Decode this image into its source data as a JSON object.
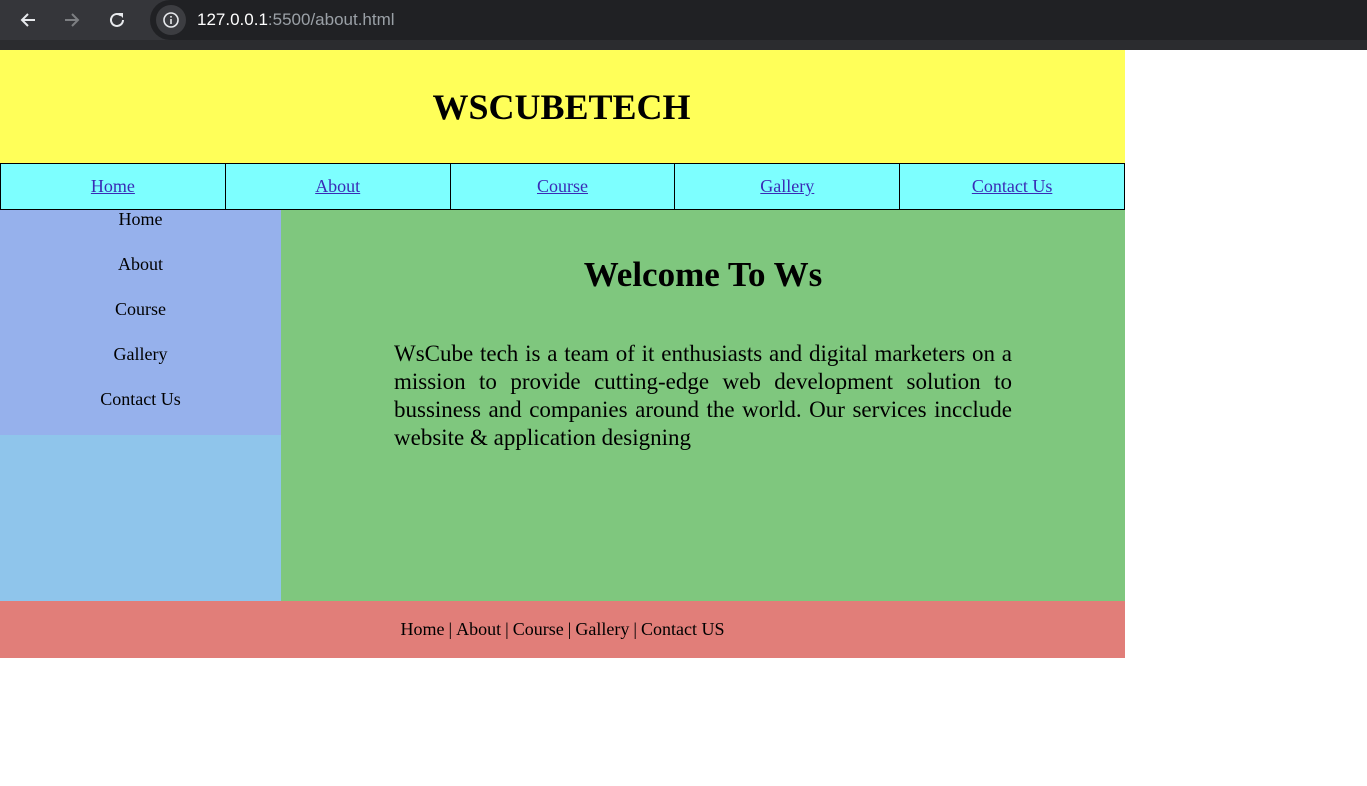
{
  "browser": {
    "url_host": "127.0.0.1",
    "url_rest": ":5500/about.html"
  },
  "header": {
    "title": "WSCUBETECH"
  },
  "topnav": [
    {
      "label": "Home"
    },
    {
      "label": "About"
    },
    {
      "label": "Course"
    },
    {
      "label": "Gallery"
    },
    {
      "label": "Contact Us"
    }
  ],
  "sidebar": [
    {
      "label": "Home"
    },
    {
      "label": "About"
    },
    {
      "label": "Course"
    },
    {
      "label": "Gallery"
    },
    {
      "label": "Contact Us"
    }
  ],
  "main": {
    "heading": "Welcome To Ws",
    "paragraph": "WsCube tech is a team of it enthusiasts and digital marketers on a mission to provide cutting-edge web development solution to bussiness and companies around the world. Our services incclude website & application designing"
  },
  "footer": {
    "links": [
      "Home",
      "About",
      "Course",
      "Gallery",
      "Contact US"
    ],
    "separator": "|"
  },
  "colors": {
    "header_bg": "#ffff59",
    "nav_bg": "#7dffff",
    "sidebar_menu_bg": "#96b1ec",
    "sidebar_bg": "#8fc5eb",
    "main_bg": "#7fc77e",
    "footer_bg": "#e17e79"
  }
}
